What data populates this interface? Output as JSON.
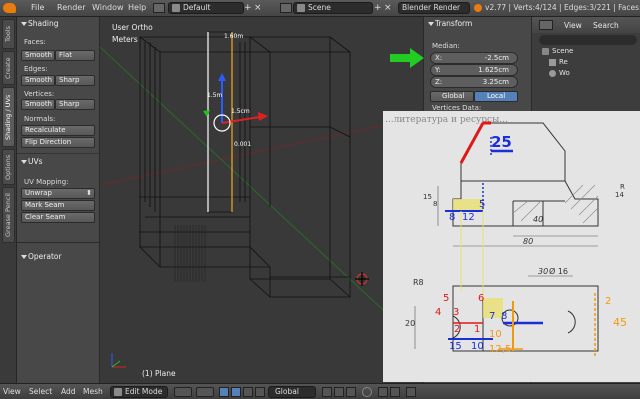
{
  "topbar": {
    "menus": [
      "File",
      "Render",
      "Window",
      "Help"
    ],
    "layout": "Default",
    "scene": "Scene",
    "engine": "Blender Render",
    "stats": "v2.77 | Verts:4/124 | Edges:3/221 | Faces:L"
  },
  "lefttabs": [
    "Tools",
    "Create",
    "Shading / UVs",
    "Options",
    "Grease Pencil"
  ],
  "shading": {
    "title": "Shading",
    "faces_label": "Faces:",
    "edges_label": "Edges:",
    "vertices_label": "Vertices:",
    "smooth": "Smooth",
    "flat": "Flat",
    "sharp": "Sharp",
    "normals_label": "Normals:",
    "recalculate": "Recalculate",
    "flip": "Flip Direction"
  },
  "uvs": {
    "title": "UVs",
    "mapping_label": "UV Mapping:",
    "unwrap": "Unwrap",
    "mark_seam": "Mark Seam",
    "clear_seam": "Clear Seam"
  },
  "operator": {
    "title": "Operator"
  },
  "viewport": {
    "view_name": "User Ortho",
    "units": "Meters",
    "object": "(1) Plane",
    "dims": {
      "top": "1.60m",
      "side": "1.5m",
      "inner": "1.5cm",
      "small": "0.001"
    }
  },
  "transform": {
    "title": "Transform",
    "median_label": "Median:",
    "x_label": "X:",
    "x_value": "-2.5cm",
    "y_label": "Y:",
    "y_value": "1.625cm",
    "z_label": "Z:",
    "z_value": "3.25cm",
    "global": "Global",
    "local": "Local",
    "vertices_data": "Vertices Data:"
  },
  "outliner": {
    "view": "View",
    "search": "Search",
    "scene": "Scene",
    "item1": "Re",
    "item2": "Wo"
  },
  "bottombar": {
    "view": "View",
    "select": "Select",
    "add": "Add",
    "mesh": "Mesh",
    "mode": "Edit Mode",
    "orientation": "Global"
  },
  "drawing": {
    "heading": "...литература и ресурсы...",
    "d25": "25",
    "d15": "15",
    "d8a": "8",
    "d8b": "8",
    "d12": "12",
    "d5": "5",
    "d40": "40",
    "d80": "80",
    "d30": "30",
    "d16": "Ø 16",
    "dR8": "R8",
    "d20": "20",
    "n5a": "5",
    "n6": "6",
    "n4": "4",
    "n3": "3",
    "n2": "2",
    "n1": "1",
    "n7": "7",
    "n8": "8",
    "d15b": "15",
    "d10": "10",
    "d10o": "10",
    "d12o": "12,5",
    "d2": "2",
    "d45": "45",
    "d14": "14",
    "dr": "R"
  },
  "colors": {
    "red": "#e01818",
    "blue": "#1a2fd6",
    "orange": "#f09a10",
    "yellow": "#e8e070",
    "green": "#22cc22"
  }
}
